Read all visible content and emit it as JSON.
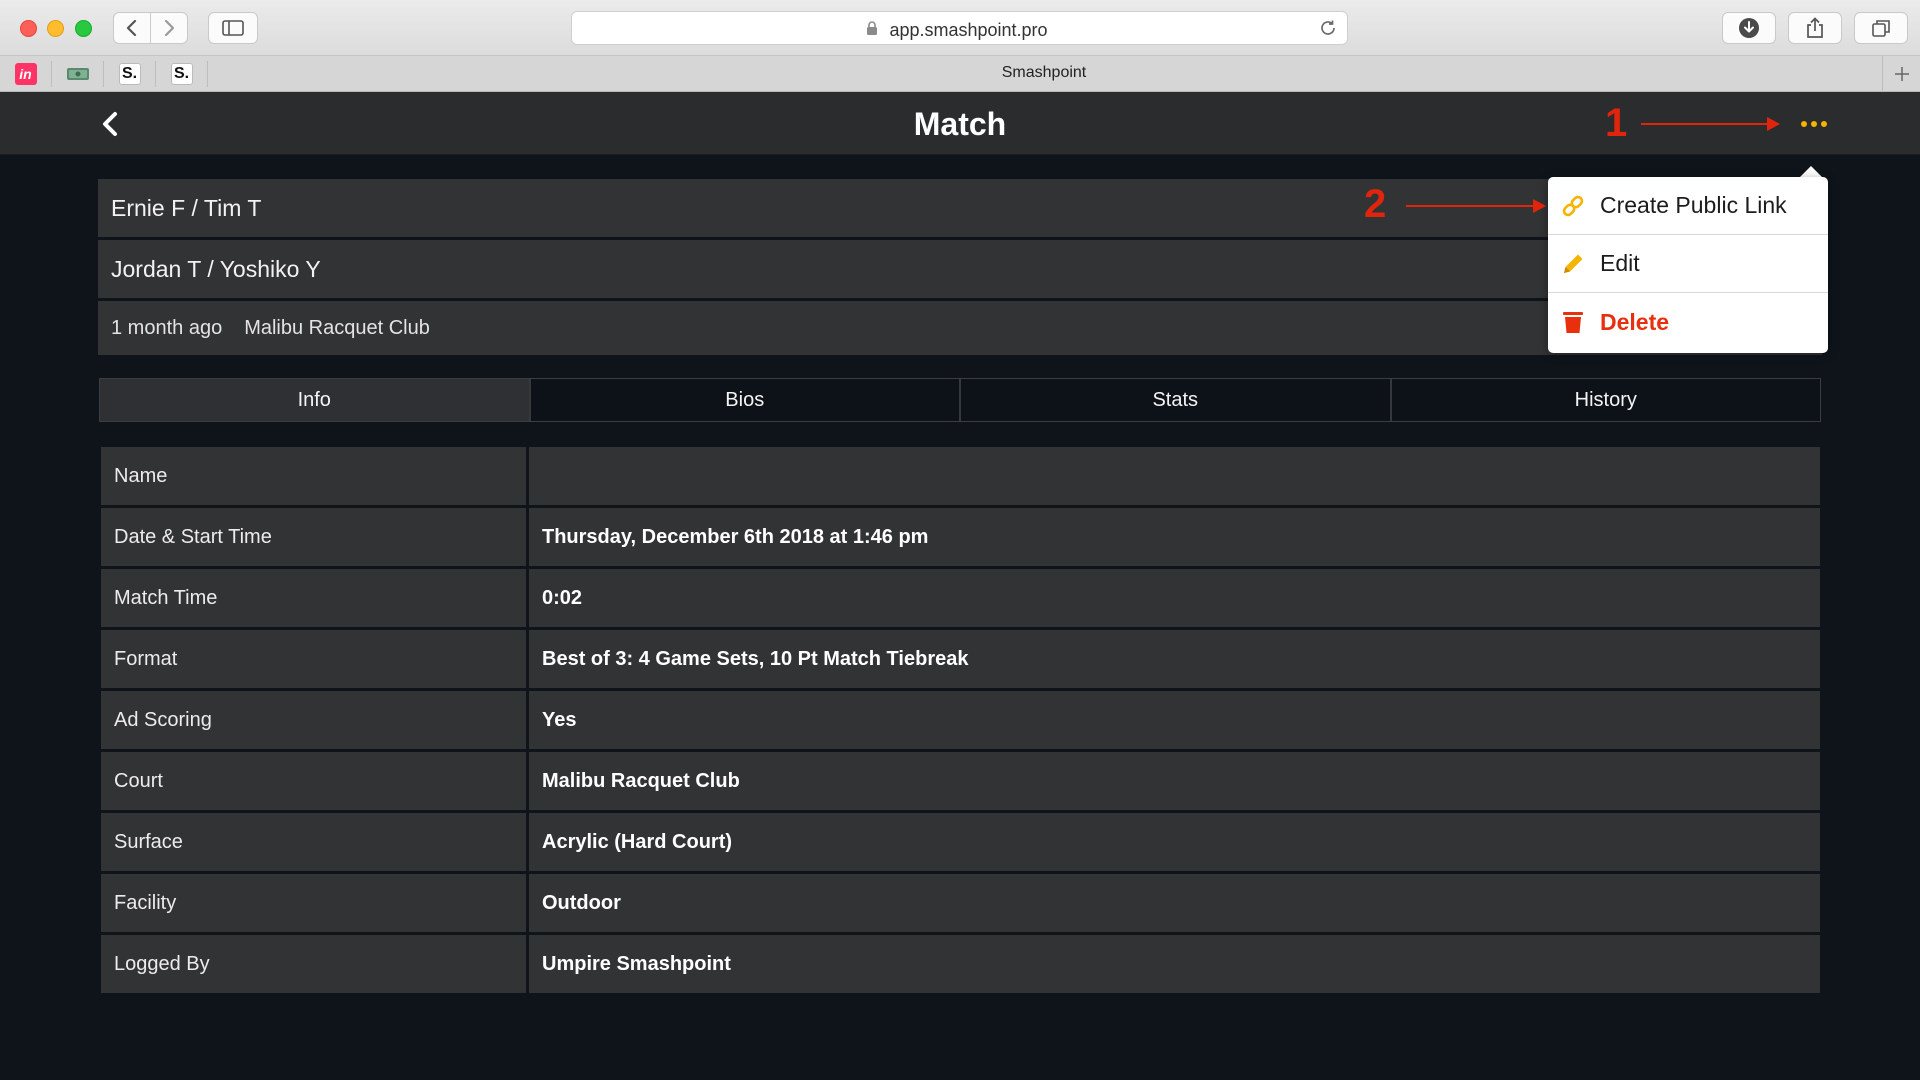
{
  "browser": {
    "url": "app.smashpoint.pro",
    "tab_title": "Smashpoint",
    "favorites": [
      {
        "icon": "invision-icon",
        "glyph": "in",
        "bg": "#ff3366",
        "fg": "#ffffff"
      },
      {
        "icon": "money-icon",
        "glyph": "",
        "bg": "#5a8a6e",
        "fg": "#ffffff"
      },
      {
        "icon": "smashpoint-favicon",
        "glyph": "S.",
        "bg": "#ffffff",
        "fg": "#111111"
      },
      {
        "icon": "smashpoint-favicon",
        "glyph": "S.",
        "bg": "#ffffff",
        "fg": "#111111"
      }
    ]
  },
  "header": {
    "title": "Match"
  },
  "match": {
    "team1": "Ernie F / Tim T",
    "team2": "Jordan T / Yoshiko Y",
    "when": "1 month ago",
    "venue": "Malibu Racquet Club"
  },
  "tabs": [
    {
      "label": "Info",
      "active": true
    },
    {
      "label": "Bios",
      "active": false
    },
    {
      "label": "Stats",
      "active": false
    },
    {
      "label": "History",
      "active": false
    }
  ],
  "info": [
    {
      "label": "Name",
      "value": ""
    },
    {
      "label": "Date & Start Time",
      "value": "Thursday, December 6th 2018 at 1:46 pm"
    },
    {
      "label": "Match Time",
      "value": "0:02"
    },
    {
      "label": "Format",
      "value": "Best of 3: 4 Game Sets, 10 Pt Match Tiebreak"
    },
    {
      "label": "Ad Scoring",
      "value": "Yes"
    },
    {
      "label": "Court",
      "value": "Malibu Racquet Club"
    },
    {
      "label": "Surface",
      "value": "Acrylic (Hard Court)"
    },
    {
      "label": "Facility",
      "value": "Outdoor"
    },
    {
      "label": "Logged By",
      "value": "Umpire Smashpoint"
    }
  ],
  "menu": {
    "items": [
      {
        "label": "Create Public Link",
        "icon": "link-icon"
      },
      {
        "label": "Edit",
        "icon": "pencil-icon"
      },
      {
        "label": "Delete",
        "icon": "trash-icon"
      }
    ]
  },
  "annotations": {
    "step1": "1",
    "step2": "2"
  },
  "colors": {
    "accent": "#f5b400",
    "danger": "#e8300f",
    "annotation": "#e1250c",
    "background": "#0f141b",
    "row": "#323335"
  }
}
